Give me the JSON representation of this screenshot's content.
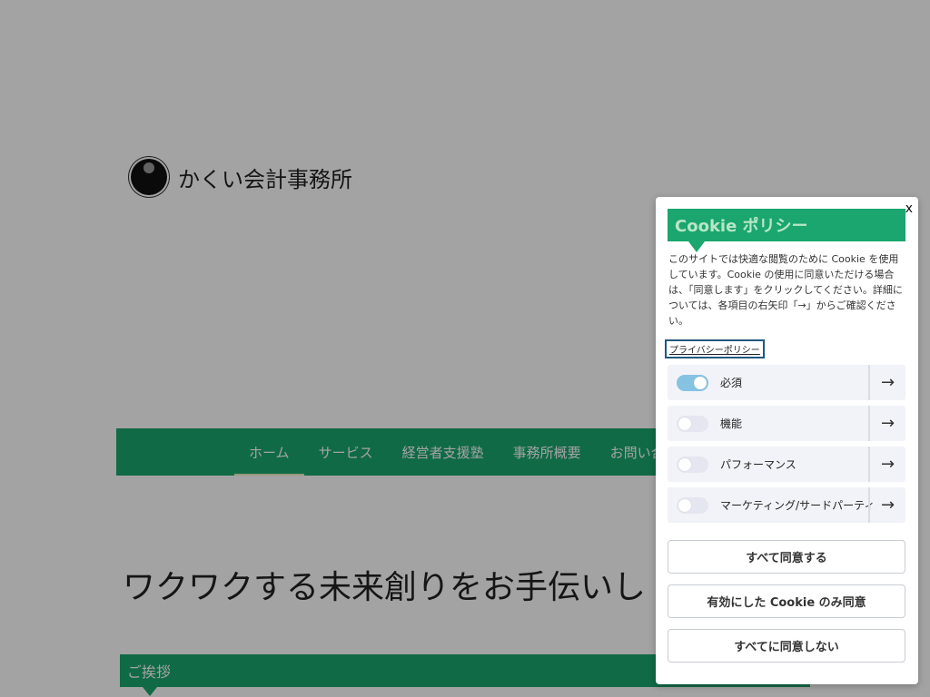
{
  "site": {
    "logo_text": "かくい会計事務所",
    "nav": [
      "ホーム",
      "サービス",
      "経営者支援塾",
      "事務所概要",
      "お問い合"
    ],
    "hero_title": "ワクワクする未来創りをお手伝いし",
    "greeting": "ご挨拶"
  },
  "cookie": {
    "close_label": "x",
    "title": "Cookie ポリシー",
    "description": "このサイトでは快適な閲覧のために Cookie を使用しています。Cookie の使用に同意いただける場合は、「同意します」をクリックしてください。詳細については、各項目の右矢印「→」からご確認ください。",
    "policy_link": "プライバシーポリシー",
    "toggles": [
      {
        "label": "必須",
        "enabled": true
      },
      {
        "label": "機能",
        "enabled": false
      },
      {
        "label": "パフォーマンス",
        "enabled": false
      },
      {
        "label": "マーケティング/サードパーティ",
        "enabled": false
      }
    ],
    "arrow_icon": "→",
    "buttons": {
      "accept_all": "すべて同意する",
      "accept_enabled": "有効にした Cookie のみ同意",
      "deny_all": "すべてに同意しない"
    }
  },
  "colors": {
    "brand_green": "#1aa66e",
    "toggle_on": "#86c2e2"
  }
}
